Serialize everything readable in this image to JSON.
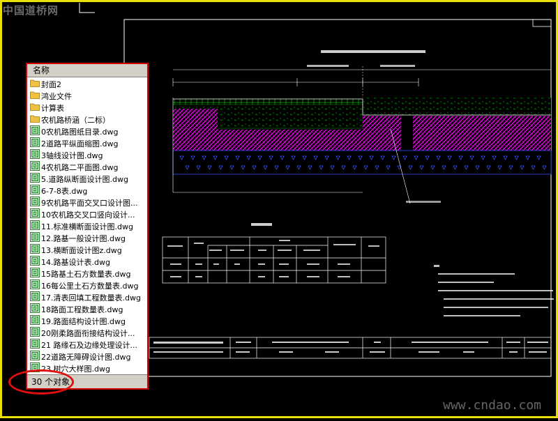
{
  "watermark_top": "中国道桥网",
  "watermark_bottom": "www.cndao.com",
  "file_panel": {
    "column_header": "名称",
    "items": [
      {
        "label": "封面2",
        "type": "folder"
      },
      {
        "label": "鸿业文件",
        "type": "folder"
      },
      {
        "label": "计算表",
        "type": "folder"
      },
      {
        "label": "农机路桥涵（二标）",
        "type": "folder"
      },
      {
        "label": "0农机路图纸目录.dwg",
        "type": "dwg"
      },
      {
        "label": "2道路平纵面缩图.dwg",
        "type": "dwg"
      },
      {
        "label": "3轴线设计图.dwg",
        "type": "dwg"
      },
      {
        "label": "4农机路二平面图.dwg",
        "type": "dwg"
      },
      {
        "label": "5.道路纵断面设计图.dwg",
        "type": "dwg"
      },
      {
        "label": "6-7-8表.dwg",
        "type": "dwg"
      },
      {
        "label": "9农机路平面交叉口设计图...",
        "type": "dwg"
      },
      {
        "label": "10农机路交叉口竖向设计...",
        "type": "dwg"
      },
      {
        "label": "11.标准横断面设计图.dwg",
        "type": "dwg"
      },
      {
        "label": "12.路基一般设计图.dwg",
        "type": "dwg"
      },
      {
        "label": "13.横断面设计图z.dwg",
        "type": "dwg"
      },
      {
        "label": "14.路基设计表.dwg",
        "type": "dwg"
      },
      {
        "label": "15路基土石方数量表.dwg",
        "type": "dwg"
      },
      {
        "label": "16每公里土石方数量表.dwg",
        "type": "dwg"
      },
      {
        "label": "17.清表回填工程数量表.dwg",
        "type": "dwg"
      },
      {
        "label": "18路面工程数量表.dwg",
        "type": "dwg"
      },
      {
        "label": "19.路面结构设计图.dwg",
        "type": "dwg"
      },
      {
        "label": "20刚柔路面衔接结构设计...",
        "type": "dwg"
      },
      {
        "label": "21 路缘石及边缘处理设计...",
        "type": "dwg"
      },
      {
        "label": "22道路无障碍设计图.dwg",
        "type": "dwg"
      },
      {
        "label": "23.树穴大样图.dwg",
        "type": "dwg"
      }
    ],
    "status": "30 个对象"
  },
  "colors": {
    "frame": "#e8e000",
    "highlight": "#e01010",
    "hatch_magenta": "#ff00ff",
    "hatch_green": "#00c000",
    "layer_blue": "#3050ff",
    "folder": "#f0c040"
  }
}
